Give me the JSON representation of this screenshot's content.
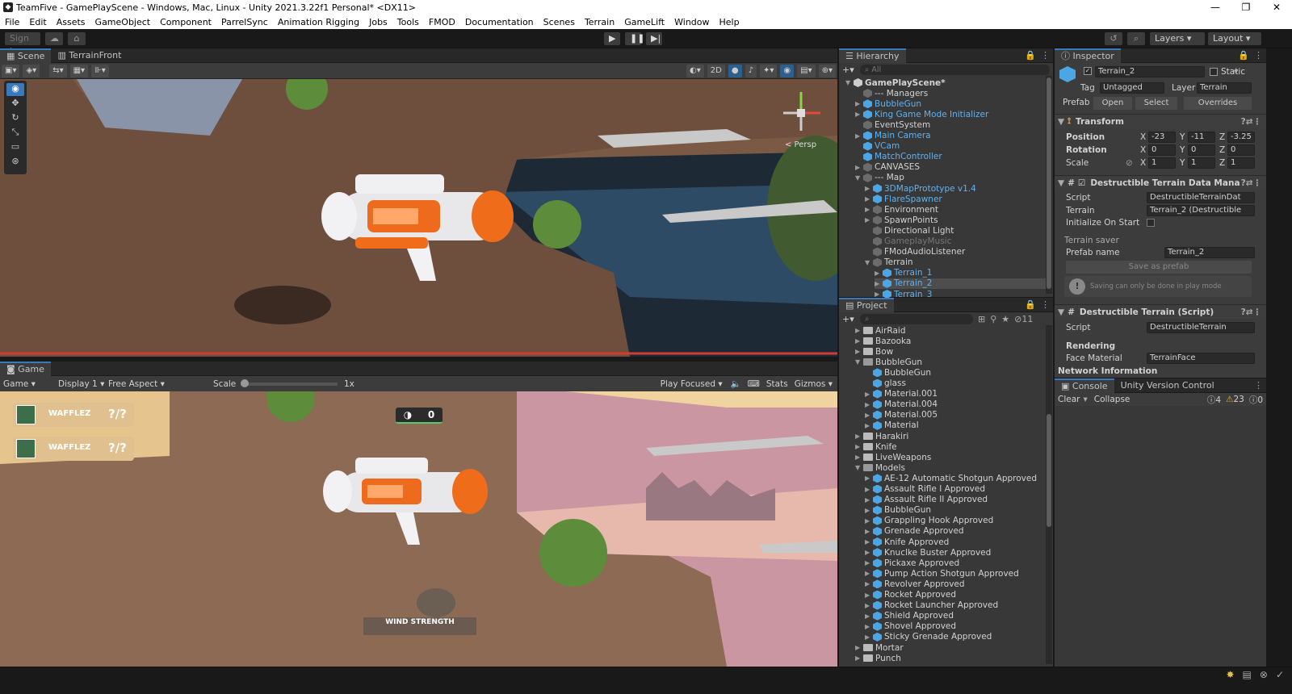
{
  "window": {
    "title": "TeamFive - GamePlayScene - Windows, Mac, Linux - Unity 2021.3.22f1 Personal* <DX11>"
  },
  "menu": [
    "File",
    "Edit",
    "Assets",
    "GameObject",
    "Component",
    "ParrelSync",
    "Animation Rigging",
    "Jobs",
    "Tools",
    "FMOD",
    "Documentation",
    "Scenes",
    "Terrain",
    "GameLift",
    "Window",
    "Help"
  ],
  "toolbar": {
    "signin": "Sign in",
    "layers": "Layers",
    "layout": "Layout"
  },
  "scene": {
    "tab1": "Scene",
    "tab2": "TerrainFront",
    "mode2d": "2D",
    "persp": "< Persp"
  },
  "game": {
    "tab": "Game",
    "view": "Game",
    "display": "Display 1",
    "aspect": "Free Aspect",
    "scale_label": "Scale",
    "scale_value": "1x",
    "play_focused": "Play Focused",
    "stats": "Stats",
    "gizmos": "Gizmos",
    "player1": "WAFFLEZ",
    "player2": "WAFFLEZ",
    "p1_score": "?/?",
    "p2_score": "?/?",
    "counter": "0",
    "wind": "WIND STRENGTH"
  },
  "hierarchy": {
    "title": "Hierarchy",
    "search": "All",
    "items": [
      {
        "label": "GamePlayScene*",
        "indent": 0,
        "arrow": "▼",
        "kind": "scene"
      },
      {
        "label": "--- Managers",
        "indent": 1,
        "arrow": "",
        "kind": "go"
      },
      {
        "label": "BubbleGun",
        "indent": 1,
        "arrow": "▶",
        "kind": "prefab"
      },
      {
        "label": "King Game Mode Initializer",
        "indent": 1,
        "arrow": "▶",
        "kind": "prefab"
      },
      {
        "label": "EventSystem",
        "indent": 1,
        "arrow": "",
        "kind": "go"
      },
      {
        "label": "Main Camera",
        "indent": 1,
        "arrow": "▶",
        "kind": "prefab"
      },
      {
        "label": "VCam",
        "indent": 1,
        "arrow": "",
        "kind": "prefab"
      },
      {
        "label": "MatchController",
        "indent": 1,
        "arrow": "",
        "kind": "prefab"
      },
      {
        "label": "CANVASES",
        "indent": 1,
        "arrow": "▶",
        "kind": "go"
      },
      {
        "label": "--- Map",
        "indent": 1,
        "arrow": "▼",
        "kind": "go"
      },
      {
        "label": "3DMapPrototype v1.4",
        "indent": 2,
        "arrow": "▶",
        "kind": "prefab"
      },
      {
        "label": "FlareSpawner",
        "indent": 2,
        "arrow": "▶",
        "kind": "prefab"
      },
      {
        "label": "Environment",
        "indent": 2,
        "arrow": "▶",
        "kind": "go"
      },
      {
        "label": "SpawnPoints",
        "indent": 2,
        "arrow": "▶",
        "kind": "go"
      },
      {
        "label": "Directional Light",
        "indent": 2,
        "arrow": "",
        "kind": "go"
      },
      {
        "label": "GameplayMusic",
        "indent": 2,
        "arrow": "",
        "kind": "dim"
      },
      {
        "label": "FModAudioListener",
        "indent": 2,
        "arrow": "",
        "kind": "go"
      },
      {
        "label": "Terrain",
        "indent": 2,
        "arrow": "▼",
        "kind": "go"
      },
      {
        "label": "Terrain_1",
        "indent": 3,
        "arrow": "▶",
        "kind": "prefab"
      },
      {
        "label": "Terrain_2",
        "indent": 3,
        "arrow": "▶",
        "kind": "prefab"
      },
      {
        "label": "Terrain_3",
        "indent": 3,
        "arrow": "▶",
        "kind": "prefab"
      }
    ]
  },
  "project": {
    "title": "Project",
    "count": "11",
    "items": [
      {
        "label": "AirRaid",
        "indent": 1,
        "arrow": "▶",
        "kind": "folder"
      },
      {
        "label": "Bazooka",
        "indent": 1,
        "arrow": "▶",
        "kind": "folder"
      },
      {
        "label": "Bow",
        "indent": 1,
        "arrow": "▶",
        "kind": "folder"
      },
      {
        "label": "BubbleGun",
        "indent": 1,
        "arrow": "▼",
        "kind": "folder"
      },
      {
        "label": "BubbleGun",
        "indent": 2,
        "arrow": "",
        "kind": "prefab"
      },
      {
        "label": "glass",
        "indent": 2,
        "arrow": "",
        "kind": "mat"
      },
      {
        "label": "Material.001",
        "indent": 2,
        "arrow": "▶",
        "kind": "mat"
      },
      {
        "label": "Material.004",
        "indent": 2,
        "arrow": "▶",
        "kind": "mat"
      },
      {
        "label": "Material.005",
        "indent": 2,
        "arrow": "▶",
        "kind": "mat"
      },
      {
        "label": "Material",
        "indent": 2,
        "arrow": "▶",
        "kind": "mat"
      },
      {
        "label": "Harakiri",
        "indent": 1,
        "arrow": "▶",
        "kind": "folder"
      },
      {
        "label": "Knife",
        "indent": 1,
        "arrow": "▶",
        "kind": "folder"
      },
      {
        "label": "LiveWeapons",
        "indent": 1,
        "arrow": "▶",
        "kind": "folder"
      },
      {
        "label": "Models",
        "indent": 1,
        "arrow": "▼",
        "kind": "folder"
      },
      {
        "label": "AE-12 Automatic Shotgun Approved",
        "indent": 2,
        "arrow": "▶",
        "kind": "model"
      },
      {
        "label": "Assault Rifle I Approved",
        "indent": 2,
        "arrow": "▶",
        "kind": "model"
      },
      {
        "label": "Assault Rifle II Approved",
        "indent": 2,
        "arrow": "▶",
        "kind": "model"
      },
      {
        "label": "BubbleGun",
        "indent": 2,
        "arrow": "▶",
        "kind": "model"
      },
      {
        "label": "Grappling Hook Approved",
        "indent": 2,
        "arrow": "▶",
        "kind": "model"
      },
      {
        "label": "Grenade Approved",
        "indent": 2,
        "arrow": "▶",
        "kind": "model"
      },
      {
        "label": "Knife Approved",
        "indent": 2,
        "arrow": "▶",
        "kind": "model"
      },
      {
        "label": "Knuclke Buster Approved",
        "indent": 2,
        "arrow": "▶",
        "kind": "model"
      },
      {
        "label": "Pickaxe Approved",
        "indent": 2,
        "arrow": "▶",
        "kind": "model"
      },
      {
        "label": "Pump Action Shotgun Approved",
        "indent": 2,
        "arrow": "▶",
        "kind": "model"
      },
      {
        "label": "Revolver Approved",
        "indent": 2,
        "arrow": "▶",
        "kind": "model"
      },
      {
        "label": "Rocket Approved",
        "indent": 2,
        "arrow": "▶",
        "kind": "model"
      },
      {
        "label": "Rocket Launcher Approved",
        "indent": 2,
        "arrow": "▶",
        "kind": "model"
      },
      {
        "label": "Shield Approved",
        "indent": 2,
        "arrow": "▶",
        "kind": "model"
      },
      {
        "label": "Shovel Approved",
        "indent": 2,
        "arrow": "▶",
        "kind": "model"
      },
      {
        "label": "Sticky Grenade Approved",
        "indent": 2,
        "arrow": "▶",
        "kind": "model"
      },
      {
        "label": "Mortar",
        "indent": 1,
        "arrow": "▶",
        "kind": "folder"
      },
      {
        "label": "Punch",
        "indent": 1,
        "arrow": "▶",
        "kind": "folder"
      }
    ]
  },
  "inspector": {
    "title": "Inspector",
    "name": "Terrain_2",
    "static": "Static",
    "tag_label": "Tag",
    "tag": "Untagged",
    "layer_label": "Layer",
    "layer": "Terrain",
    "prefab_label": "Prefab",
    "open": "Open",
    "select": "Select",
    "overrides": "Overrides",
    "transform": "Transform",
    "position": "Position",
    "rotation": "Rotation",
    "scale": "Scale",
    "pos": [
      "-23",
      "-11",
      "-3.25"
    ],
    "rot": [
      "0",
      "0",
      "0"
    ],
    "scl": [
      "1",
      "1",
      "1"
    ],
    "comp1": "Destructible Terrain Data Mana",
    "script_label": "Script",
    "script1": "DestructibleTerrainDat",
    "terrain_label": "Terrain",
    "terrain_ref": "Terrain_2 (Destructible",
    "init_label": "Initialize On Start",
    "saver": "Terrain saver",
    "prefab_name_label": "Prefab name",
    "prefab_name": "Terrain_2",
    "save_btn": "Save as prefab",
    "warn": "Saving can only be done in play mode",
    "comp2": "Destructible Terrain (Script)",
    "script2": "DestructibleTerrain",
    "rendering": "Rendering",
    "face_label": "Face Material",
    "face": "TerrainFace",
    "network": "Network Information"
  },
  "console": {
    "tab1": "Console",
    "tab2": "Unity Version Control",
    "clear": "Clear",
    "collapse": "Collapse",
    "info": "4",
    "warn": "23",
    "err": "0"
  }
}
